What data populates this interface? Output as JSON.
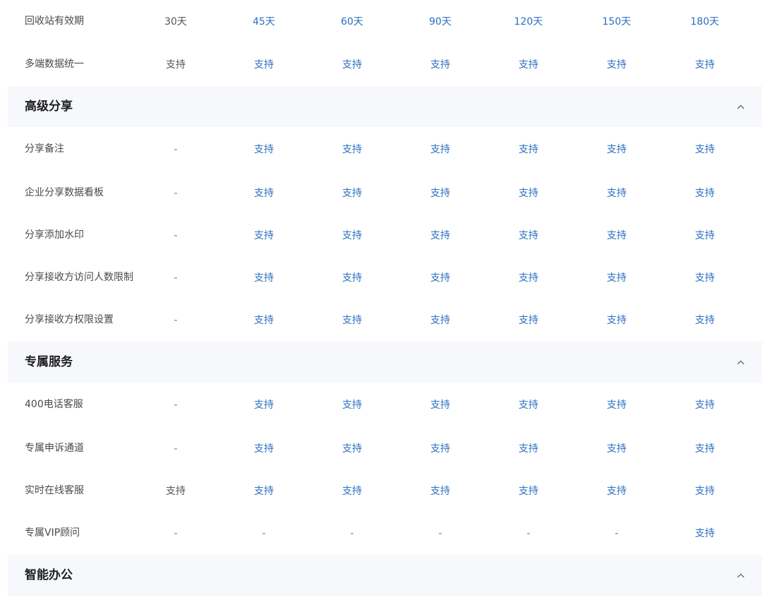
{
  "sections": {
    "top": {
      "rows": [
        {
          "label": "回收站有效期",
          "values": [
            "30天",
            "45天",
            "60天",
            "90天",
            "120天",
            "150天",
            "180天"
          ],
          "first_style": "gray"
        },
        {
          "label": "多端数据统一",
          "values": [
            "支持",
            "支持",
            "支持",
            "支持",
            "支持",
            "支持",
            "支持"
          ],
          "first_style": "gray"
        }
      ]
    },
    "advanced_share": {
      "title": "高级分享",
      "toggle_icon": "chevron-up-icon",
      "rows": [
        {
          "label": "分享备注",
          "values": [
            "-",
            "支持",
            "支持",
            "支持",
            "支持",
            "支持",
            "支持"
          ]
        },
        {
          "label": "企业分享数据看板",
          "values": [
            "-",
            "支持",
            "支持",
            "支持",
            "支持",
            "支持",
            "支持"
          ]
        },
        {
          "label": "分享添加水印",
          "values": [
            "-",
            "支持",
            "支持",
            "支持",
            "支持",
            "支持",
            "支持"
          ]
        },
        {
          "label": "分享接收方访问人数限制",
          "values": [
            "-",
            "支持",
            "支持",
            "支持",
            "支持",
            "支持",
            "支持"
          ]
        },
        {
          "label": "分享接收方权限设置",
          "values": [
            "-",
            "支持",
            "支持",
            "支持",
            "支持",
            "支持",
            "支持"
          ]
        }
      ]
    },
    "exclusive_service": {
      "title": "专属服务",
      "toggle_icon": "chevron-up-icon",
      "rows": [
        {
          "label": "400电话客服",
          "values": [
            "-",
            "支持",
            "支持",
            "支持",
            "支持",
            "支持",
            "支持"
          ]
        },
        {
          "label": "专属申诉通道",
          "values": [
            "-",
            "支持",
            "支持",
            "支持",
            "支持",
            "支持",
            "支持"
          ]
        },
        {
          "label": "实时在线客服",
          "values": [
            "支持",
            "支持",
            "支持",
            "支持",
            "支持",
            "支持",
            "支持"
          ],
          "first_style": "gray"
        },
        {
          "label": "专属VIP顾问",
          "values": [
            "-",
            "-",
            "-",
            "-",
            "-",
            "-",
            "支持"
          ]
        }
      ]
    },
    "smart_office": {
      "title": "智能办公",
      "toggle_icon": "chevron-up-icon"
    }
  },
  "colors": {
    "supported_blue": "#2c6fc1",
    "header_bg": "#f6f8fb",
    "plain_gray": "#555555"
  }
}
